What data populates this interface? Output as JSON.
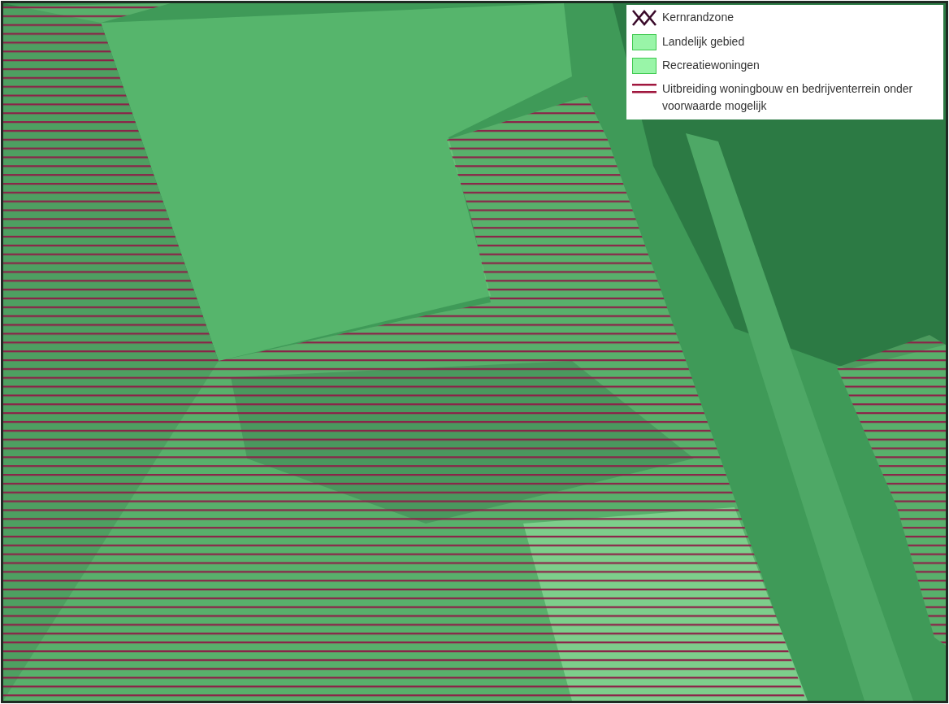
{
  "legend": {
    "items": [
      {
        "kind": "cross",
        "label": "Kernrandzone"
      },
      {
        "kind": "fill",
        "label": "Landelijk gebied"
      },
      {
        "kind": "fill",
        "label": "Recreatiewoningen"
      },
      {
        "kind": "lines",
        "label": "Uitbreiding woningbouw en bedrijventerrein onder voorwaarde mogelijk"
      }
    ]
  }
}
